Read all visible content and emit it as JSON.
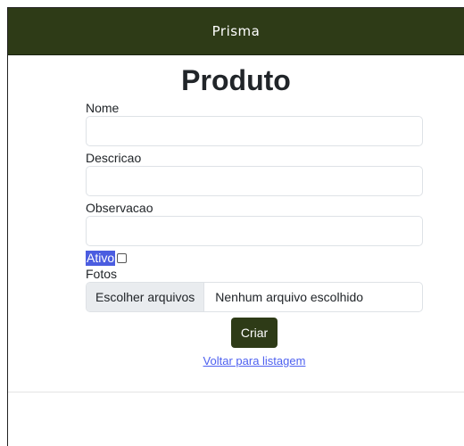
{
  "navbar": {
    "brand": "Prisma"
  },
  "page": {
    "title": "Produto"
  },
  "form": {
    "nome_label": "Nome",
    "nome_value": "",
    "descricao_label": "Descricao",
    "descricao_value": "",
    "observacao_label": "Observacao",
    "observacao_value": "",
    "ativo_label": "Ativo",
    "ativo_checked": false,
    "fotos_label": "Fotos",
    "fotos_button": "Escolher arquivos",
    "fotos_status": "Nenhum arquivo escolhido",
    "submit_label": "Criar"
  },
  "links": {
    "back": "Voltar para listagem"
  },
  "colors": {
    "navbar": "#2e3b17",
    "button": "#2e3b17",
    "link": "#4e61f0",
    "ativo_highlight": "#4b5de0"
  }
}
